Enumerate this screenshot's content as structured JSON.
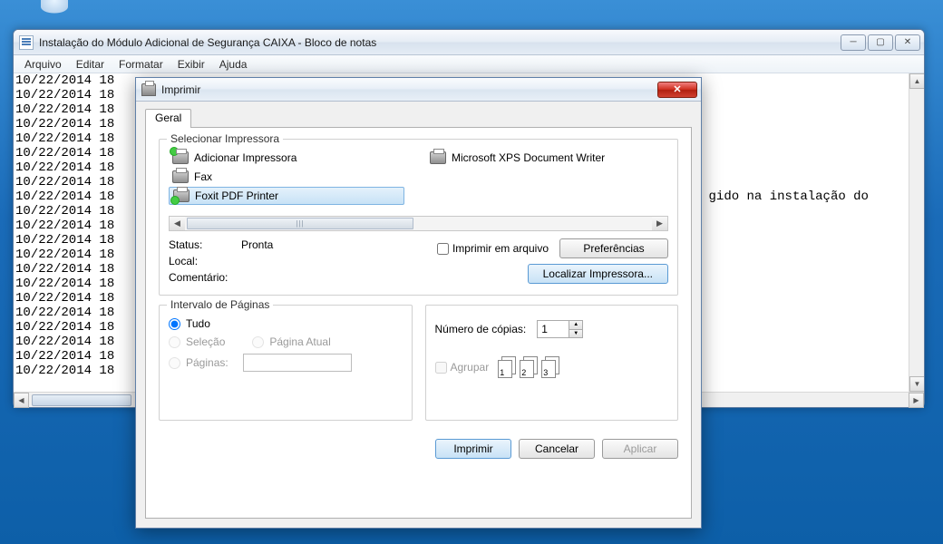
{
  "notepad": {
    "title": "Instalação do Módulo Adicional de Segurança CAIXA - Bloco de notas",
    "menus": [
      "Arquivo",
      "Editar",
      "Formatar",
      "Exibir",
      "Ajuda"
    ],
    "lines": [
      "10/22/2014 18",
      "10/22/2014 18",
      "10/22/2014 18",
      "10/22/2014 18",
      "10/22/2014 18",
      "10/22/2014 18",
      "10/22/2014 18",
      "10/22/2014 18",
      "10/22/2014 18                                                                              gido na instalação do",
      "10/22/2014 18",
      "10/22/2014 18",
      "10/22/2014 18",
      "10/22/2014 18",
      "10/22/2014 18",
      "10/22/2014 18",
      "10/22/2014 18",
      "10/22/2014 18",
      "10/22/2014 18",
      "10/22/2014 18",
      "10/22/2014 18",
      "10/22/2014 18"
    ]
  },
  "print": {
    "title": "Imprimir",
    "tab_general": "Geral",
    "group_select_printer": "Selecionar Impressora",
    "printers": {
      "add": "Adicionar Impressora",
      "fax": "Fax",
      "foxit": "Foxit PDF Printer",
      "xps": "Microsoft XPS Document Writer"
    },
    "status_label": "Status:",
    "status_value": "Pronta",
    "local_label": "Local:",
    "local_value": "",
    "comment_label": "Comentário:",
    "comment_value": "",
    "print_to_file": "Imprimir em arquivo",
    "btn_prefs": "Preferências",
    "btn_find": "Localizar Impressora...",
    "group_range": "Intervalo de Páginas",
    "radio_all": "Tudo",
    "radio_selection": "Seleção",
    "radio_current": "Página Atual",
    "radio_pages": "Páginas:",
    "copies_label": "Número de cópias:",
    "copies_value": "1",
    "collate_label": "Agrupar",
    "collate_pages": [
      "1",
      "1",
      "2",
      "2",
      "3",
      "3"
    ],
    "btn_print": "Imprimir",
    "btn_cancel": "Cancelar",
    "btn_apply": "Aplicar"
  }
}
